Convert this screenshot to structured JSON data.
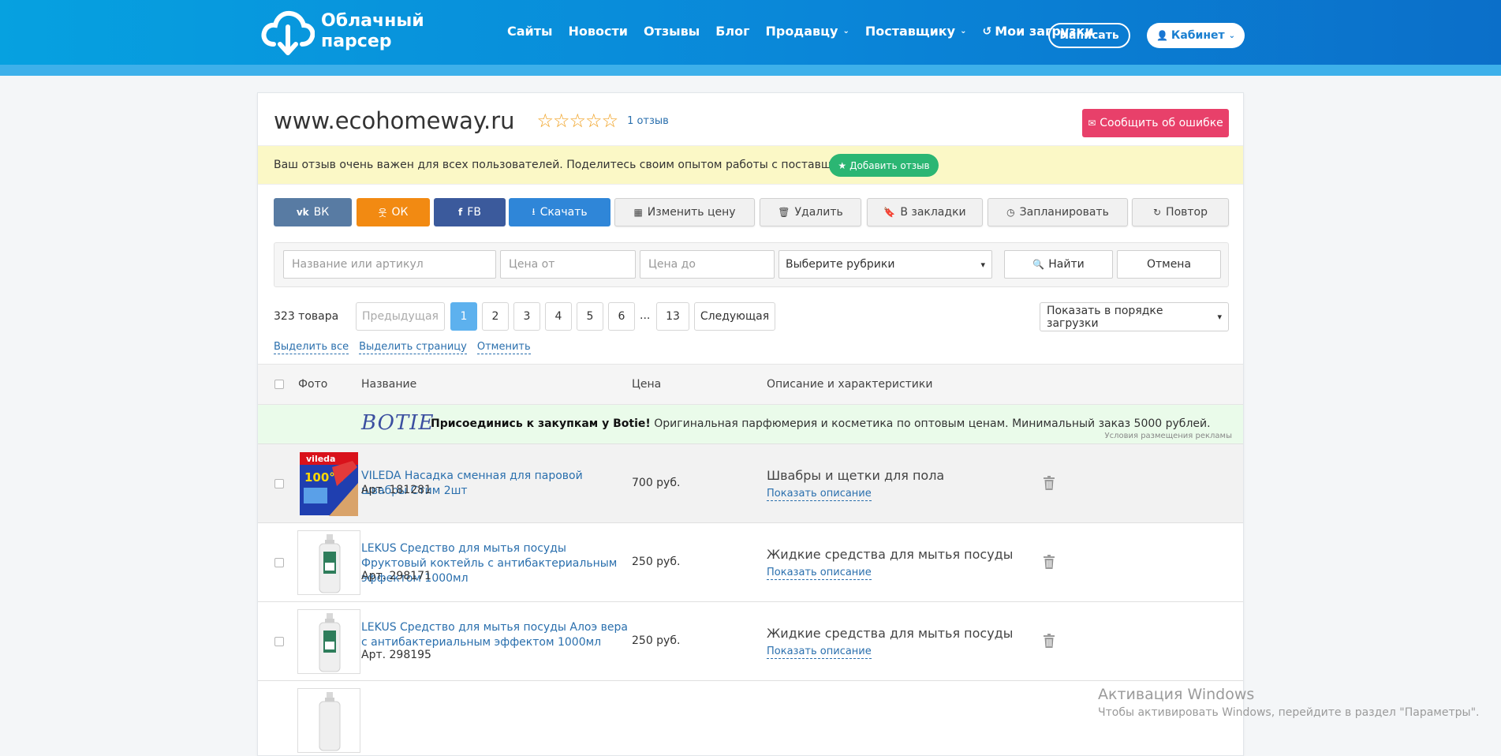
{
  "header": {
    "logo_line1": "Облачный",
    "logo_line2": "парсер",
    "nav": [
      {
        "label": "Сайты"
      },
      {
        "label": "Новости"
      },
      {
        "label": "Отзывы"
      },
      {
        "label": "Блог"
      },
      {
        "label": "Продавцу",
        "dropdown": true
      },
      {
        "label": "Поставщику",
        "dropdown": true
      },
      {
        "label": "Мои загрузки",
        "icon": "history-icon"
      }
    ],
    "write_label": "Написать",
    "cabinet_label": "Кабинет",
    "colors": {
      "primary": "#0a86d8",
      "stripe": "#3db0ea"
    }
  },
  "site": {
    "title": "www.ecohomeway.ru",
    "stars": "☆☆☆☆☆",
    "reviews": "1 отзыв",
    "report_label": "Сообщить об ошибке"
  },
  "notice": {
    "text": "Ваш отзыв очень важен для всех пользователей. Поделитесь своим опытом работы с поставщиком.",
    "add_review_label": "Добавить отзыв"
  },
  "actions": {
    "vk": "ВК",
    "ok": "ОК",
    "fb": "FB",
    "download": "Скачать",
    "change_price": "Изменить цену",
    "delete": "Удалить",
    "bookmarks": "В закладки",
    "schedule": "Запланировать",
    "repeat": "Повтор",
    "colors": {
      "vk": "#587ba3",
      "ok": "#f28a12",
      "fb": "#3b5a9c",
      "download": "#2f86d8"
    }
  },
  "filter": {
    "name_placeholder": "Название или артикул",
    "price_from_placeholder": "Цена от",
    "price_to_placeholder": "Цена до",
    "category_selected": "Выберите рубрики",
    "search_label": "Найти",
    "cancel_label": "Отмена"
  },
  "listing": {
    "count": "323 товара",
    "prev": "Предыдущая",
    "next": "Следующая",
    "pages": [
      "1",
      "2",
      "3",
      "4",
      "5",
      "6"
    ],
    "dots": "...",
    "last_page": "13",
    "current_page": "1",
    "sort_selected": "Показать в порядке загрузки",
    "select_all": "Выделить все",
    "select_page": "Выделить страницу",
    "cancel_selection": "Отменить"
  },
  "table": {
    "headers": {
      "photo": "Фото",
      "name": "Название",
      "price": "Цена",
      "description": "Описание и характеристики"
    }
  },
  "ad": {
    "logo": "BOTIE",
    "bold": "Присоединись к закупкам у Botie!",
    "text": " Оригинальная парфюмерия и косметика по оптовым ценам. Минимальный заказ 5000 рублей.",
    "terms": "Условия размещения рекламы"
  },
  "products": [
    {
      "name": "VILEDA Насадка сменная для паровой швабры Стим 2шт",
      "article": "Арт. 181281",
      "price": "700 руб.",
      "category": "Швабры и щетки для пола",
      "show_desc": "Показать описание"
    },
    {
      "name": "LEKUS Средство для мытья посуды Фруктовый коктейль с антибактериальным эффектом 1000мл",
      "article": "Арт. 298171",
      "price": "250 руб.",
      "category": "Жидкие средства для мытья посуды",
      "show_desc": "Показать описание"
    },
    {
      "name": "LEKUS Средство для мытья посуды Алоэ вера с антибактериальным эффектом 1000мл",
      "article": "Арт. 298195",
      "price": "250 руб.",
      "category": "Жидкие средства для мытья посуды",
      "show_desc": "Показать описание"
    }
  ],
  "watermark": {
    "line1": "Активация Windows",
    "line2": "Чтобы активировать Windows, перейдите в раздел \"Параметры\"."
  }
}
